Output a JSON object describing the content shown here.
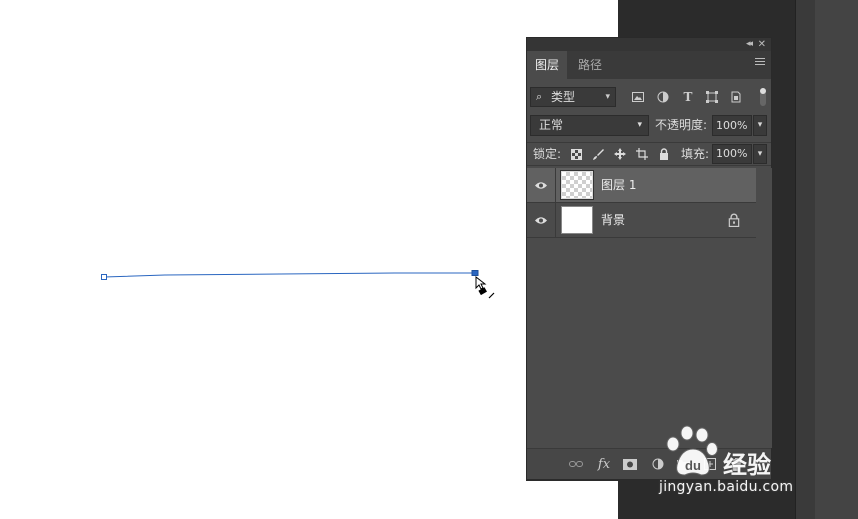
{
  "panel": {
    "tabs": [
      {
        "label": "图层",
        "active": true
      },
      {
        "label": "路径",
        "active": false
      }
    ],
    "filter": {
      "icon": "search-icon",
      "label": "类型"
    },
    "blend_mode": "正常",
    "opacity_label": "不透明度:",
    "opacity_value": "100%",
    "lock_label": "锁定:",
    "fill_label": "填充:",
    "fill_value": "100%",
    "layers": [
      {
        "name": "图层 1",
        "selected": true,
        "visible": true,
        "thumbnail": "transparent"
      },
      {
        "name": "背景",
        "selected": false,
        "visible": true,
        "thumbnail": "white",
        "locked": true
      }
    ]
  },
  "watermark": {
    "brand": "经验",
    "url": "jingyan.baidu.com"
  },
  "colors": {
    "path_stroke": "#2a66c0",
    "panel_bg": "#4b4b4b",
    "selected_layer": "#616161"
  }
}
